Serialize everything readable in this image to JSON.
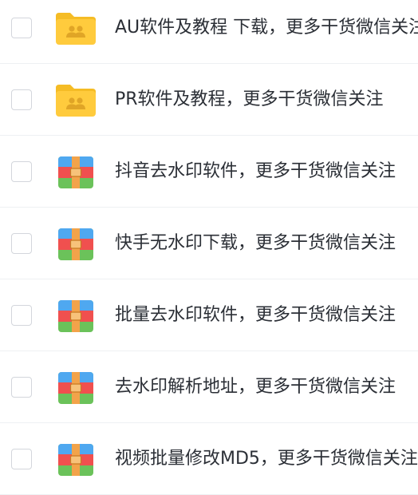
{
  "colors": {
    "folder": "#FFCB3D",
    "folder_tab": "#F5BC25",
    "archive_blue": "#4FA8F0",
    "archive_red": "#F0504F",
    "archive_green": "#6BC25A",
    "archive_strap": "#F2A34A",
    "text": "#2B2F36",
    "divider": "#EEF0F3"
  },
  "files": [
    {
      "name": "AU软件及教程 下载，更多干货微信关注",
      "icon": "shared-folder-icon"
    },
    {
      "name": "PR软件及教程，更多干货微信关注",
      "icon": "shared-folder-icon"
    },
    {
      "name": "抖音去水印软件，更多干货微信关注",
      "icon": "archive-icon"
    },
    {
      "name": "快手无水印下载，更多干货微信关注",
      "icon": "archive-icon"
    },
    {
      "name": "批量去水印软件，更多干货微信关注",
      "icon": "archive-icon"
    },
    {
      "name": "去水印解析地址，更多干货微信关注",
      "icon": "archive-icon"
    },
    {
      "name": "视频批量修改MD5，更多干货微信关注",
      "icon": "archive-icon"
    }
  ]
}
